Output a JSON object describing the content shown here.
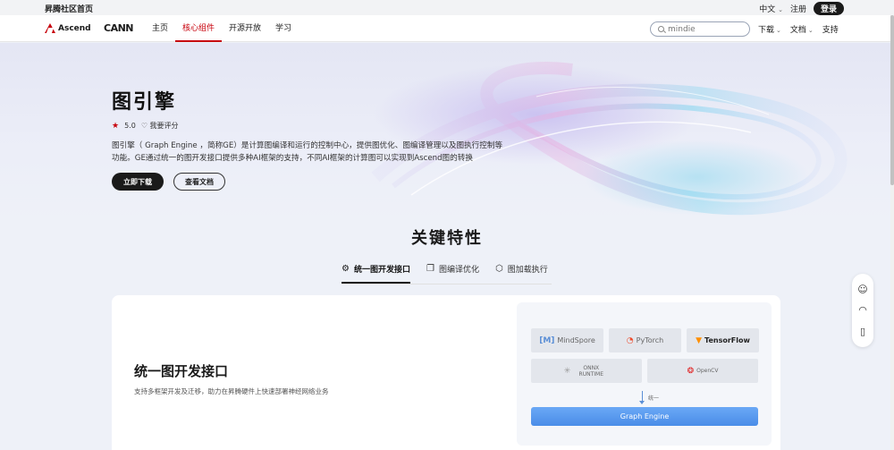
{
  "topbar": {
    "home_link": "昇腾社区首页",
    "language": "中文",
    "register": "注册",
    "login": "登录"
  },
  "nav": {
    "logo_text": "Ascend",
    "product": "CANN",
    "items": [
      {
        "label": "主页"
      },
      {
        "label": "核心组件",
        "active": true
      },
      {
        "label": "开源开放"
      },
      {
        "label": "学习"
      }
    ],
    "search_placeholder": "mindie",
    "right": {
      "download": "下载",
      "docs": "文档",
      "support": "支持"
    }
  },
  "hero": {
    "title": "图引擎",
    "rating": "5.0",
    "rate_me": "我要评分",
    "description": "图引擎（ Graph Engine ，简称GE）是计算图编译和运行的控制中心，提供图优化、图编译管理以及图执行控制等功能。GE通过统一的图开发接口提供多种AI框架的支持，不同AI框架的计算图可以实现到Ascend图的转换",
    "download_button": "立即下载",
    "docs_button": "查看文档"
  },
  "features": {
    "section_title": "关键特性",
    "tabs": [
      {
        "label": "统一图开发接口",
        "active": true
      },
      {
        "label": "图编译优化"
      },
      {
        "label": "图加载执行"
      }
    ],
    "card": {
      "title": "统一图开发接口",
      "description": "支持多框架开发及迁移，助力在昇腾硬件上快速部署神经网络业务",
      "diagram": {
        "frameworks": [
          "MindSpore",
          "PyTorch",
          "TensorFlow",
          "ONNX RUNTIME",
          "OpenCV"
        ],
        "unify_label": "统一",
        "engine": "Graph Engine"
      }
    }
  },
  "colors": {
    "accent": "#c7000b",
    "dark": "#1a1a1a",
    "engine_blue": "#4a8de8"
  }
}
